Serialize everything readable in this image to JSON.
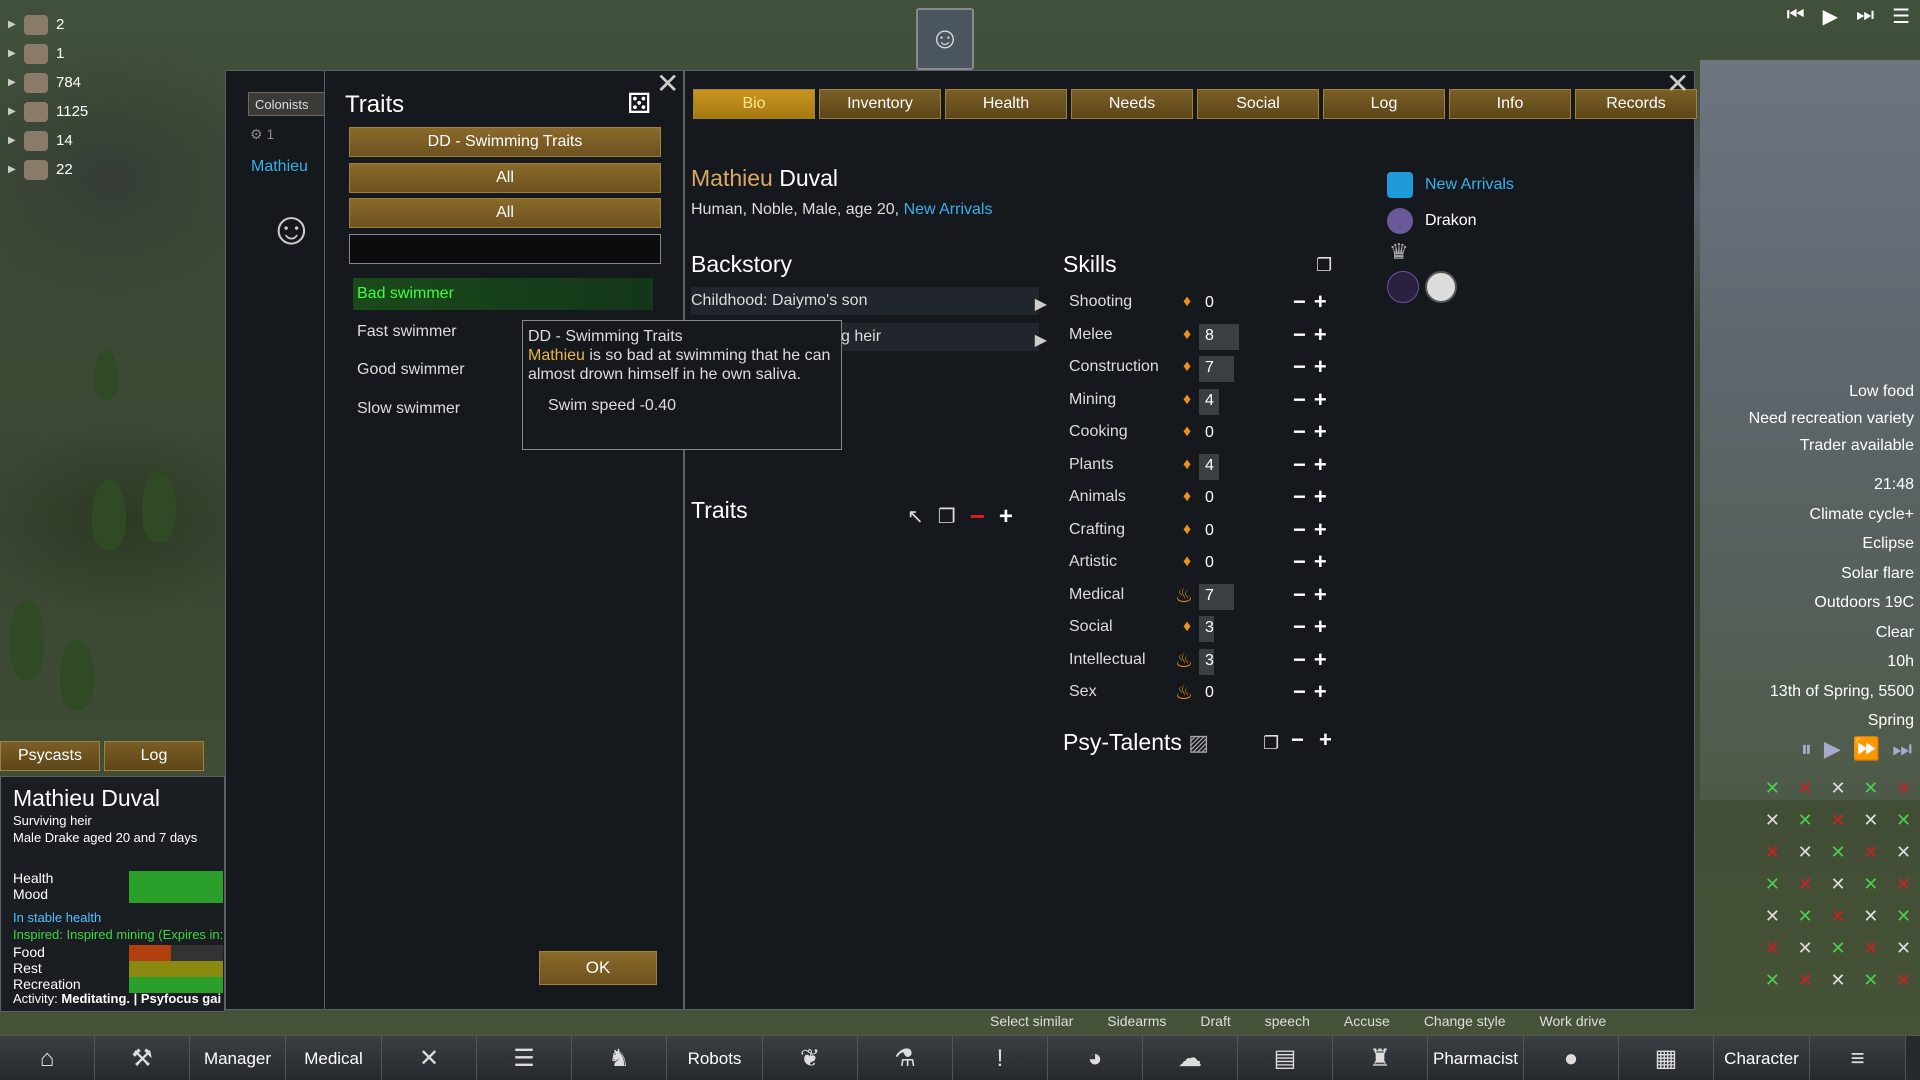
{
  "resources": [
    {
      "icon": "colonist-icon",
      "value": "2"
    },
    {
      "icon": "wood-icon",
      "value": "1"
    },
    {
      "icon": "steel-icon",
      "value": "784"
    },
    {
      "icon": "silver-icon",
      "value": "1125"
    },
    {
      "icon": "medicine-icon",
      "value": "14"
    },
    {
      "icon": "food-icon",
      "value": "22"
    }
  ],
  "pawn_list": {
    "tab_label": "Colonists",
    "count": "1",
    "pawn_name": "Mathieu"
  },
  "traits_dialog": {
    "title": "Traits",
    "source_filter": "DD - Swimming Traits",
    "filter_1": "All",
    "filter_2": "All",
    "search_value": "",
    "items": [
      {
        "label": "Bad swimmer",
        "selected": true
      },
      {
        "label": "Fast swimmer",
        "selected": false
      },
      {
        "label": "Good swimmer",
        "selected": false
      },
      {
        "label": "Slow swimmer",
        "selected": false
      }
    ],
    "ok_label": "OK"
  },
  "tooltip": {
    "source": "DD - Swimming Traits",
    "name": "Mathieu",
    "desc": " is so bad at swimming that he can almost drown himself in he own saliva.",
    "stat": "Swim speed -0.40"
  },
  "char_window": {
    "tabs": [
      "Bio",
      "Inventory",
      "Health",
      "Needs",
      "Social",
      "Log",
      "Info",
      "Records"
    ],
    "active_tab": "Bio",
    "first_name": "Mathieu",
    "last_name": " Duval",
    "subtitle": "Human, Noble, Male, age 20, ",
    "faction_link": "New Arrivals",
    "backstory_heading": "Backstory",
    "childhood": "Childhood: Daiymo's son",
    "adulthood": "g heir",
    "traits_heading": "Traits",
    "skills_heading": "Skills",
    "psy_heading": "Psy-Talents",
    "faction_items": [
      {
        "icon": "house-icon",
        "label": "New Arrivals",
        "color": "#3ab0e8"
      },
      {
        "icon": "ideology-icon",
        "label": "Drakon",
        "color": "#ffffff"
      }
    ],
    "skills": [
      {
        "name": "Shooting",
        "passion": "minor",
        "level": "0",
        "bar": 0
      },
      {
        "name": "Melee",
        "passion": "minor",
        "level": "8",
        "bar": 0.8
      },
      {
        "name": "Construction",
        "passion": "minor",
        "level": "7",
        "bar": 0.7
      },
      {
        "name": "Mining",
        "passion": "minor",
        "level": "4",
        "bar": 0.4
      },
      {
        "name": "Cooking",
        "passion": "minor",
        "level": "0",
        "bar": 0
      },
      {
        "name": "Plants",
        "passion": "minor",
        "level": "4",
        "bar": 0.4
      },
      {
        "name": "Animals",
        "passion": "minor",
        "level": "0",
        "bar": 0
      },
      {
        "name": "Crafting",
        "passion": "minor",
        "level": "0",
        "bar": 0
      },
      {
        "name": "Artistic",
        "passion": "minor",
        "level": "0",
        "bar": 0
      },
      {
        "name": "Medical",
        "passion": "major",
        "level": "7",
        "bar": 0.7
      },
      {
        "name": "Social",
        "passion": "minor",
        "level": "3",
        "bar": 0.3
      },
      {
        "name": "Intellectual",
        "passion": "major",
        "level": "3",
        "bar": 0.3
      },
      {
        "name": "Sex",
        "passion": "major",
        "level": "0",
        "bar": 0
      }
    ]
  },
  "alerts": [
    "Low food",
    "Need recreation variety",
    "Trader available"
  ],
  "date_info": [
    "21:48",
    "Climate cycle+",
    "Eclipse",
    "Solar flare",
    "Outdoors 19C",
    "Clear",
    "10h",
    "13th of Spring, 5500",
    "Spring"
  ],
  "inspect_tabs": [
    "Psycasts",
    "Log"
  ],
  "inspect": {
    "name": "Mathieu Duval",
    "title": "Surviving heir",
    "desc": "Male Drake aged 20 and 7 days",
    "needs": [
      {
        "label": "Health",
        "value": 1.0,
        "color": "#2aa02a"
      },
      {
        "label": "Mood",
        "value": 1.0,
        "color": "#2aa02a"
      },
      {
        "label": "Food",
        "value": 0.45,
        "color": "#b04010"
      },
      {
        "label": "Rest",
        "value": 1.0,
        "color": "#8a8a10"
      },
      {
        "label": "Recreation",
        "value": 1.0,
        "color": "#2aa02a"
      }
    ],
    "health_note": "In stable health",
    "inspiration_note": "Inspired: Inspired mining (Expires in:",
    "activity_prefix": "Activity: ",
    "activity": "Meditating. | Psyfocus gai"
  },
  "command_labels": [
    "Select similar",
    "Sidearms",
    "Draft",
    "speech",
    "Accuse",
    "Change style",
    "Work drive"
  ],
  "bottom_bar": [
    {
      "type": "icon",
      "icon": "home-icon",
      "glyph": "⌂"
    },
    {
      "type": "icon",
      "icon": "hammer-icon",
      "glyph": "⚒"
    },
    {
      "type": "text",
      "label": "Manager"
    },
    {
      "type": "text",
      "label": "Medical"
    },
    {
      "type": "icon",
      "icon": "work-icon",
      "glyph": "✕"
    },
    {
      "type": "icon",
      "icon": "schedule-icon",
      "glyph": "☰"
    },
    {
      "type": "icon",
      "icon": "animals-icon",
      "glyph": "♞"
    },
    {
      "type": "text",
      "label": "Robots"
    },
    {
      "type": "icon",
      "icon": "wildlife-icon",
      "glyph": "❦"
    },
    {
      "type": "icon",
      "icon": "research-icon",
      "glyph": "⚗"
    },
    {
      "type": "icon",
      "icon": "quest-icon",
      "glyph": "!"
    },
    {
      "type": "icon",
      "icon": "world-icon",
      "glyph": "◕"
    },
    {
      "type": "icon",
      "icon": "factions-icon",
      "glyph": "☁"
    },
    {
      "type": "icon",
      "icon": "history-icon",
      "glyph": "▤"
    },
    {
      "type": "icon",
      "icon": "ideology-icon",
      "glyph": "♜"
    },
    {
      "type": "text",
      "label": "Pharmacist"
    },
    {
      "type": "icon",
      "icon": "tips-icon",
      "glyph": "●"
    },
    {
      "type": "icon",
      "icon": "storage-icon",
      "glyph": "▦"
    },
    {
      "type": "text",
      "label": "Character"
    },
    {
      "type": "icon",
      "icon": "menu-icon",
      "glyph": "≡"
    }
  ]
}
